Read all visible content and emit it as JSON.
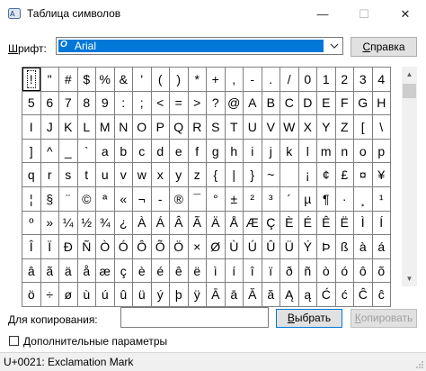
{
  "window": {
    "title": "Таблица символов",
    "minimize_icon": "minimize-icon",
    "maximize_icon": "maximize-icon",
    "close_icon": "close-icon"
  },
  "font": {
    "label_underlined": "Ш",
    "label_rest": "рифт:",
    "selected": "Arial",
    "help_label_underlined": "С",
    "help_label_rest": "правка"
  },
  "grid": {
    "selected_index": 0,
    "rows": [
      [
        "!",
        "\"",
        "#",
        "$",
        "%",
        "&",
        "'",
        "(",
        ")",
        "*",
        "+",
        ",",
        "-",
        ".",
        "/",
        "0",
        "1",
        "2",
        "3",
        "4"
      ],
      [
        "5",
        "6",
        "7",
        "8",
        "9",
        ":",
        ";",
        "<",
        "=",
        ">",
        "?",
        "@",
        "A",
        "B",
        "C",
        "D",
        "E",
        "F",
        "G",
        "H"
      ],
      [
        "I",
        "J",
        "K",
        "L",
        "M",
        "N",
        "O",
        "P",
        "Q",
        "R",
        "S",
        "T",
        "U",
        "V",
        "W",
        "X",
        "Y",
        "Z",
        "[",
        "\\"
      ],
      [
        "]",
        "^",
        "_",
        "`",
        "a",
        "b",
        "c",
        "d",
        "e",
        "f",
        "g",
        "h",
        "i",
        "j",
        "k",
        "l",
        "m",
        "n",
        "o",
        "p"
      ],
      [
        "q",
        "r",
        "s",
        "t",
        "u",
        "v",
        "w",
        "x",
        "y",
        "z",
        "{",
        "|",
        "}",
        "~",
        " ",
        "¡",
        "¢",
        "£",
        "¤",
        "¥"
      ],
      [
        "¦",
        "§",
        "¨",
        "©",
        "ª",
        "«",
        "¬",
        "-",
        "®",
        "¯",
        "°",
        "±",
        "²",
        "³",
        "´",
        "µ",
        "¶",
        "·",
        "¸",
        "¹"
      ],
      [
        "º",
        "»",
        "¼",
        "½",
        "¾",
        "¿",
        "À",
        "Á",
        "Â",
        "Ã",
        "Ä",
        "Å",
        "Æ",
        "Ç",
        "È",
        "É",
        "Ê",
        "Ë",
        "Ì",
        "Í"
      ],
      [
        "Î",
        "Ï",
        "Ð",
        "Ñ",
        "Ò",
        "Ó",
        "Ô",
        "Õ",
        "Ö",
        "×",
        "Ø",
        "Ù",
        "Ú",
        "Û",
        "Ü",
        "Ý",
        "Þ",
        "ß",
        "à",
        "á"
      ],
      [
        "â",
        "ã",
        "ä",
        "å",
        "æ",
        "ç",
        "è",
        "é",
        "ê",
        "ë",
        "ì",
        "í",
        "î",
        "ï",
        "ð",
        "ñ",
        "ò",
        "ó",
        "ô",
        "õ"
      ],
      [
        "ö",
        "÷",
        "ø",
        "ù",
        "ú",
        "û",
        "ü",
        "ý",
        "þ",
        "ÿ",
        "Ā",
        "ā",
        "Ă",
        "ă",
        "Ą",
        "ą",
        "Ć",
        "ć",
        "Ĉ",
        "ĉ"
      ]
    ]
  },
  "copy": {
    "label": "Для копирования:",
    "value": "",
    "select_label_underlined": "В",
    "select_label_rest": "ыбрать",
    "copy_label_underlined": "К",
    "copy_label_rest": "опировать"
  },
  "advanced": {
    "label_underlined": "Д",
    "label_rest": "ополнительные параметры",
    "checked": false
  },
  "status": {
    "text": "U+0021: Exclamation Mark"
  },
  "colors": {
    "selection": "#0078d7",
    "grid_border": "#7f7f7f"
  }
}
